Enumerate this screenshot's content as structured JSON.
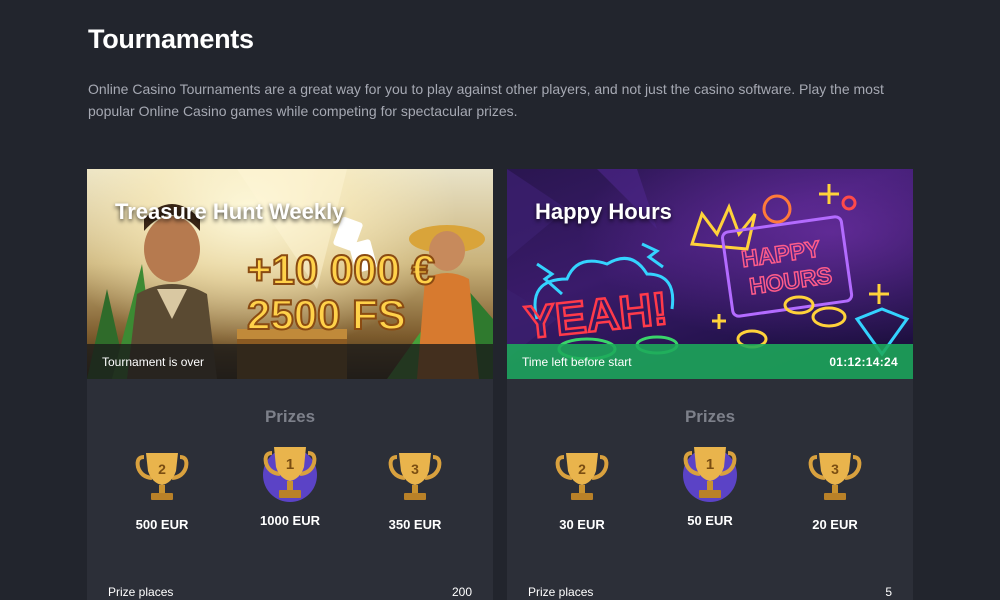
{
  "page": {
    "title": "Tournaments",
    "intro": "Online Casino Tournaments are a great way for you to play against other players, and not just the casino software. Play the most popular Online Casino games while competing for spectacular prizes."
  },
  "tournaments": [
    {
      "name": "Treasure Hunt Weekly",
      "banner_promo_line1": "+10 000 €",
      "banner_promo_line2": "2500 FS",
      "status_text": "Tournament is over",
      "timer": "",
      "prizes_heading": "Prizes",
      "prizes": [
        {
          "place": "2",
          "amount": "500 EUR"
        },
        {
          "place": "1",
          "amount": "1000 EUR"
        },
        {
          "place": "3",
          "amount": "350 EUR"
        }
      ],
      "prize_places_label": "Prize places",
      "prize_places_value": "200"
    },
    {
      "name": "Happy Hours",
      "banner_neon_1": "HAPPY",
      "banner_neon_2": "HOURS",
      "banner_neon_3": "YEAH!",
      "status_text": "Time left before start",
      "timer": "01:12:14:24",
      "prizes_heading": "Prizes",
      "prizes": [
        {
          "place": "2",
          "amount": "30 EUR"
        },
        {
          "place": "1",
          "amount": "50 EUR"
        },
        {
          "place": "3",
          "amount": "20 EUR"
        }
      ],
      "prize_places_label": "Prize places",
      "prize_places_value": "5"
    }
  ],
  "colors": {
    "background": "#22252d",
    "card": "#2c2f38",
    "muted_text": "#a6a9b3",
    "status_live": "#1caa5a",
    "trophy_gold": "#e9b44c",
    "first_place_circle": "#5b43c6"
  }
}
